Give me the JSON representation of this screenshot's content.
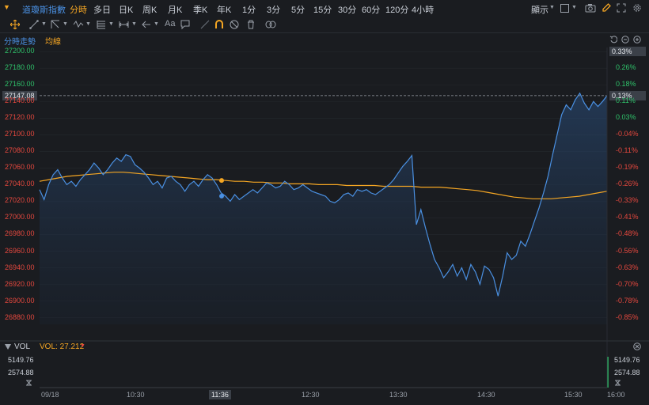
{
  "header": {
    "symbol": "道瓊斯指數",
    "periods": [
      "分時",
      "多日",
      "日K",
      "周K",
      "月K",
      "季K",
      "年K",
      "1分",
      "3分",
      "5分",
      "15分",
      "30分",
      "60分",
      "120分",
      "4小時"
    ],
    "active_period": "分時",
    "display_label": "顯示"
  },
  "toolbar": {
    "text_tool": "Aa"
  },
  "chart_header": {
    "title": "分時走勢",
    "avg_label": "均線"
  },
  "colors": {
    "price_line": "#4a90e2",
    "avg_line": "#f5a623",
    "up": "#2fc26a",
    "down": "#e5483e",
    "accent": "#f5a623"
  },
  "chart_data": {
    "type": "line",
    "y_ticks_left": [
      "27200.00",
      "27180.00",
      "27160.00",
      "27147.08",
      "27140.00",
      "27120.00",
      "27100.00",
      "27080.00",
      "27060.00",
      "27040.00",
      "27020.00",
      "27000.00",
      "26980.00",
      "26960.00",
      "26940.00",
      "26920.00",
      "26900.00",
      "26880.00"
    ],
    "y_ticks_right": [
      "0.33%",
      "0.26%",
      "0.18%",
      "0.13%",
      "0.11%",
      "0.03%",
      "-0.04%",
      "-0.11%",
      "-0.19%",
      "-0.26%",
      "-0.33%",
      "-0.41%",
      "-0.48%",
      "-0.56%",
      "-0.63%",
      "-0.70%",
      "-0.78%",
      "-0.85%"
    ],
    "ylim": [
      26872,
      27205
    ],
    "x_ticks": [
      "09/18",
      "10:30",
      "11:36",
      "12:30",
      "13:30",
      "14:30",
      "15:30",
      "16:00"
    ],
    "current_price": "27147.08",
    "current_pct": "0.13%",
    "series": [
      {
        "name": "分時走勢",
        "values": [
          27034,
          27022,
          27040,
          27052,
          27058,
          27048,
          27040,
          27044,
          27038,
          27046,
          27052,
          27058,
          27066,
          27060,
          27052,
          27058,
          27066,
          27072,
          27068,
          27076,
          27074,
          27064,
          27060,
          27055,
          27048,
          27040,
          27044,
          27036,
          27048,
          27050,
          27044,
          27040,
          27032,
          27040,
          27044,
          27038,
          27046,
          27052,
          27048,
          27040,
          27030,
          27026,
          27020,
          27028,
          27022,
          27026,
          27030,
          27034,
          27030,
          27036,
          27042,
          27040,
          27036,
          27038,
          27044,
          27040,
          27034,
          27036,
          27040,
          27036,
          27032,
          27030,
          27028,
          27026,
          27020,
          27018,
          27022,
          27028,
          27030,
          27026,
          27034,
          27032,
          27034,
          27030,
          27028,
          27032,
          27036,
          27040,
          27046,
          27054,
          27062,
          27068,
          27075,
          26992,
          27010,
          26988,
          26968,
          26950,
          26940,
          26928,
          26935,
          26944,
          26930,
          26940,
          26926,
          26944,
          26935,
          26920,
          26942,
          26938,
          26928,
          26906,
          26930,
          26958,
          26950,
          26955,
          26972,
          26966,
          26980,
          26996,
          27012,
          27030,
          27050,
          27076,
          27100,
          27124,
          27136,
          27130,
          27142,
          27150,
          27138,
          27130,
          27140,
          27134,
          27140,
          27147
        ]
      },
      {
        "name": "均線",
        "values": [
          27044,
          27046,
          27048,
          27050,
          27051,
          27052,
          27053,
          27054,
          27055,
          27055,
          27054,
          27053,
          27052,
          27051,
          27050,
          27049,
          27048,
          27047,
          27046,
          27046,
          27045,
          27044,
          27044,
          27043,
          27043,
          27042,
          27042,
          27041,
          27041,
          27041,
          27040,
          27040,
          27040,
          27039,
          27039,
          27039,
          27039,
          27038,
          27038,
          27038,
          27038,
          27037,
          27037,
          27037,
          27036,
          27035,
          27034,
          27033,
          27031,
          27029,
          27027,
          27025,
          27024,
          27023,
          27023,
          27023,
          27024,
          27025,
          27026,
          27028,
          27030,
          27032
        ]
      }
    ]
  },
  "volume": {
    "label": "VOL",
    "value": "VOL: 27.212",
    "ticks": [
      "5149.76",
      "2574.88"
    ]
  }
}
